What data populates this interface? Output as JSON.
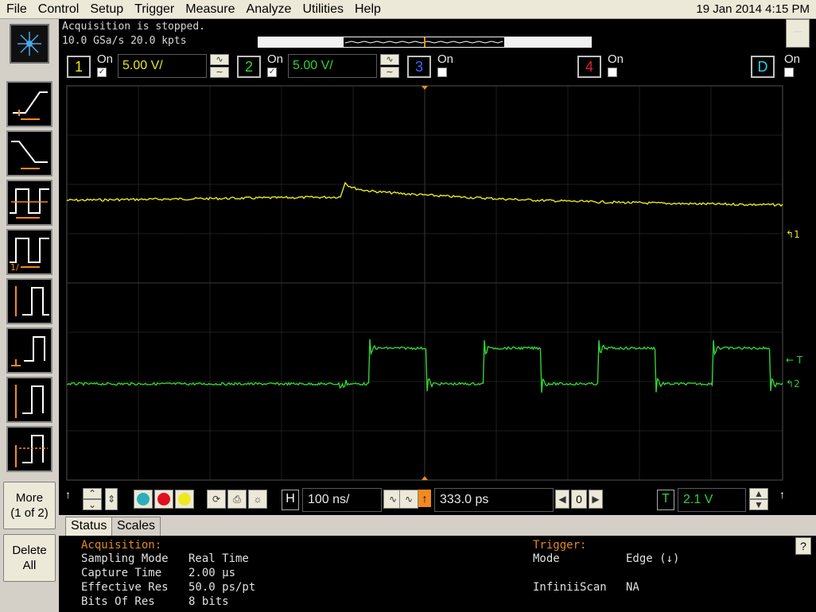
{
  "menubar": {
    "items": [
      "File",
      "Control",
      "Setup",
      "Trigger",
      "Measure",
      "Analyze",
      "Utilities",
      "Help"
    ],
    "datetime": "19 Jan 2014  4:15 PM"
  },
  "acquisition": {
    "state": "Acquisition is stopped.",
    "rate": "10.0 GSa/s   20.0 kpts"
  },
  "channels": {
    "ch1": {
      "num": "1",
      "on": "On",
      "scale": "5.00 V/",
      "color": "#e8e81e"
    },
    "ch2": {
      "num": "2",
      "on": "On",
      "scale": "5.00 V/",
      "color": "#32d232"
    },
    "ch3": {
      "num": "3",
      "on": "On",
      "color": "#3c64ff"
    },
    "ch4": {
      "num": "4",
      "on": "On",
      "color": "#e61e3c"
    },
    "digital": {
      "num": "D",
      "on": "On",
      "color": "#2ad2e8"
    }
  },
  "markers": {
    "ch1": "1",
    "ch2": "2",
    "trigger": "T"
  },
  "left_panel": {
    "more": "More\n(1 of 2)",
    "delete_all": "Delete\nAll"
  },
  "horizontal": {
    "h_label": "H",
    "scale": "100 ns/",
    "position": "333.0 ps",
    "ref": "0",
    "trigger_label": "T",
    "trigger_level": "2.1 V"
  },
  "tabs": [
    "Status",
    "Scales"
  ],
  "status": {
    "acquisition_heading": "Acquisition:",
    "rows": [
      {
        "label": "Sampling Mode",
        "value": "Real Time"
      },
      {
        "label": "Capture Time",
        "value": "2.00 µs"
      },
      {
        "label": "Effective Res",
        "value": "50.0 ps/pt"
      },
      {
        "label": "Bits Of Res",
        "value": "8 bits"
      }
    ],
    "trigger_heading": "Trigger:",
    "trigger_rows": [
      {
        "label": "Mode",
        "value": "Edge (↓)"
      },
      {
        "label": "InfiniiScan",
        "value": "NA"
      }
    ],
    "help": "?"
  }
}
